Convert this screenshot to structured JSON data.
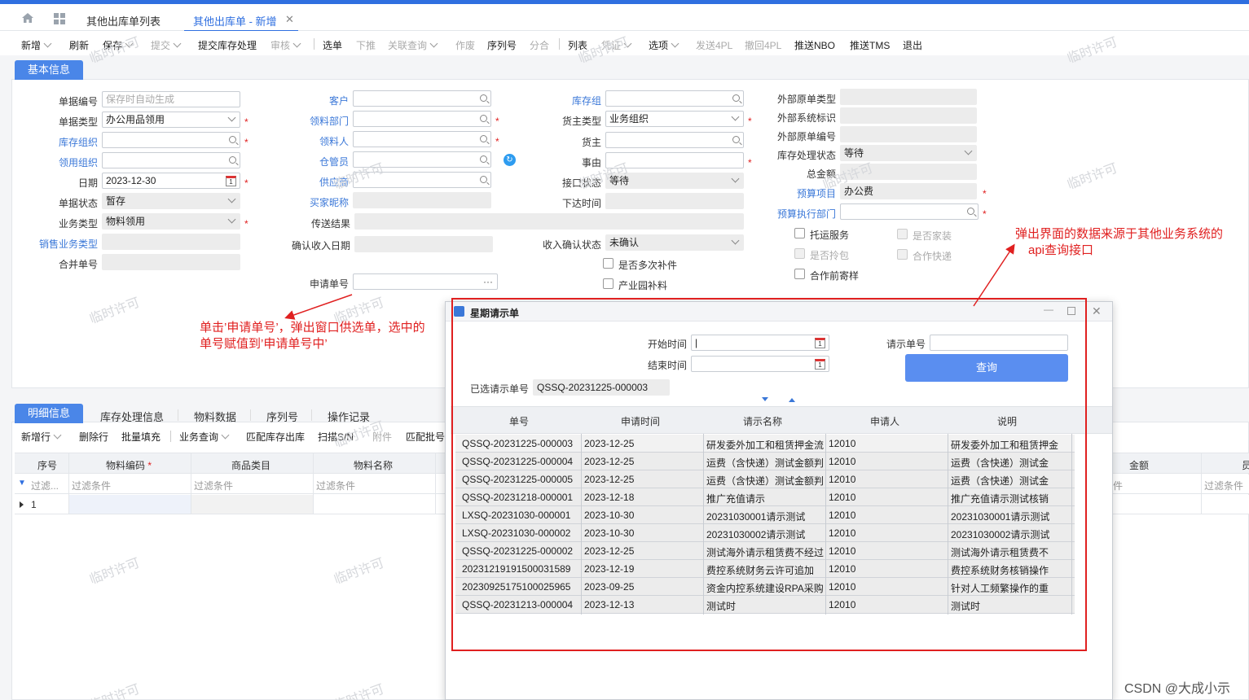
{
  "tabs": {
    "list_tab": "其他出库单列表",
    "active_tab": "其他出库单 - 新增",
    "close": "✕"
  },
  "toolbar": {
    "items": [
      "新增",
      "刷新",
      "保存",
      "提交",
      "提交库存处理",
      "审核",
      "选单",
      "下推",
      "关联查询",
      "作废",
      "序列号",
      "分合",
      "列表",
      "凭证",
      "选项",
      "发送4PL",
      "撤回4PL",
      "推送NBO",
      "推送TMS",
      "退出"
    ]
  },
  "basic": {
    "section_tab": "基本信息",
    "col1": {
      "doc_no_label": "单据编号",
      "doc_no_placeholder": "保存时自动生成",
      "doc_type_label": "单据类型",
      "doc_type_value": "办公用品领用",
      "stock_org_label": "库存组织",
      "use_org_label": "领用组织",
      "date_label": "日期",
      "date_value": "2023-12-30",
      "status_label": "单据状态",
      "status_value": "暂存",
      "biz_type_label": "业务类型",
      "biz_type_value": "物料领用",
      "sales_biz_label": "销售业务类型",
      "merge_label": "合并单号"
    },
    "col2": {
      "customer_label": "客户",
      "dept_label": "领料部门",
      "picker_label": "领料人",
      "keeper_label": "仓管员",
      "supplier_label": "供应商",
      "buyer_nick_label": "买家昵称",
      "send_result_label": "传送结果",
      "confirm_date_label": "确认收入日期",
      "apply_no_label": "申请单号",
      "apply_no_btn": "···"
    },
    "col3": {
      "stock_group_label": "库存组",
      "owner_type_label": "货主类型",
      "owner_type_value": "业务组织",
      "owner_label": "货主",
      "reason_label": "事由",
      "iface_status_label": "接口状态",
      "iface_status_value": "等待",
      "issue_time_label": "下达时间",
      "income_status_label": "收入确认状态",
      "income_status_value": "未确认",
      "multi_patch_label": "是否多次补件",
      "park_patch_label": "产业园补料"
    },
    "col4": {
      "ext_type_label": "外部原单类型",
      "ext_sys_label": "外部系统标识",
      "ext_no_label": "外部原单编号",
      "stock_status_label": "库存处理状态",
      "stock_status_value": "等待",
      "total_label": "总金额",
      "budget_item_label": "预算项目",
      "budget_item_value": "办公费",
      "budget_dept_label": "预算执行部门",
      "cb_ship": "托运服务",
      "cb_home": "是否家装",
      "cb_bag": "是否拎包",
      "cb_coop_express": "合作快递",
      "cb_consign": "合作前寄样"
    }
  },
  "detail": {
    "tabs": [
      "明细信息",
      "库存处理信息",
      "物料数据",
      "序列号",
      "操作记录"
    ],
    "toolbar": [
      "新增行",
      "删除行",
      "批量填充",
      "业务查询",
      "匹配库存出库",
      "扫描S/N",
      "附件",
      "匹配批号"
    ],
    "columns": [
      "序号",
      "物料编码",
      "商品类目",
      "物料名称",
      "金额"
    ],
    "filter_placeholder": "过滤条件",
    "filter_short": "过滤...",
    "filter_short2": "件",
    "row1_no": "1",
    "cut_col": "员"
  },
  "dialog": {
    "title": "星期请示单",
    "start_label": "开始时间",
    "end_label": "结束时间",
    "req_no_label": "请示单号",
    "query_btn": "查询",
    "selected_label": "已选请示单号",
    "selected_value": "QSSQ-20231225-000003",
    "columns": [
      "单号",
      "申请时间",
      "请示名称",
      "申请人",
      "说明"
    ],
    "rows": [
      [
        "QSSQ-20231225-000003",
        "2023-12-25",
        "研发委外加工和租赁押金流",
        "12010",
        "研发委外加工和租赁押金"
      ],
      [
        "QSSQ-20231225-000004",
        "2023-12-25",
        "运费（含快递）测试金额判",
        "12010",
        "运费（含快递）测试金"
      ],
      [
        "QSSQ-20231225-000005",
        "2023-12-25",
        "运费（含快递）测试金额判",
        "12010",
        "运费（含快递）测试金"
      ],
      [
        "QSSQ-20231218-000001",
        "2023-12-18",
        "推广充值请示",
        "12010",
        "推广充值请示测试核销"
      ],
      [
        "LXSQ-20231030-000001",
        "2023-10-30",
        "20231030001请示测试",
        "12010",
        "20231030001请示测试"
      ],
      [
        "LXSQ-20231030-000002",
        "2023-10-30",
        "20231030002请示测试",
        "12010",
        "20231030002请示测试"
      ],
      [
        "QSSQ-20231225-000002",
        "2023-12-25",
        "测试海外请示租赁费不经过",
        "12010",
        "测试海外请示租赁费不"
      ],
      [
        "20231219191500031589",
        "2023-12-19",
        "费控系统财务云许可追加",
        "12010",
        "费控系统财务核销操作"
      ],
      [
        "20230925175100025965",
        "2023-09-25",
        "资金内控系统建设RPA采购",
        "12010",
        "针对人工频繁操作的重"
      ],
      [
        "QSSQ-20231213-000004",
        "2023-12-13",
        "测试时",
        "12010",
        "测试时"
      ]
    ]
  },
  "annotations": {
    "left_line1": "单击’申请单号’，弹出窗口供选单，选中的",
    "left_line2": "单号赋值到’申请单号中’",
    "right_line1": "弹出界面的数据来源于其他业务系统的",
    "right_line2": "api查询接口"
  },
  "watermark": "临时许可",
  "footer_credit": "CSDN @大成小示",
  "colors": {
    "accent": "#2f6fe0",
    "annotation": "#e02020",
    "section_tab": "#4a86e8"
  }
}
